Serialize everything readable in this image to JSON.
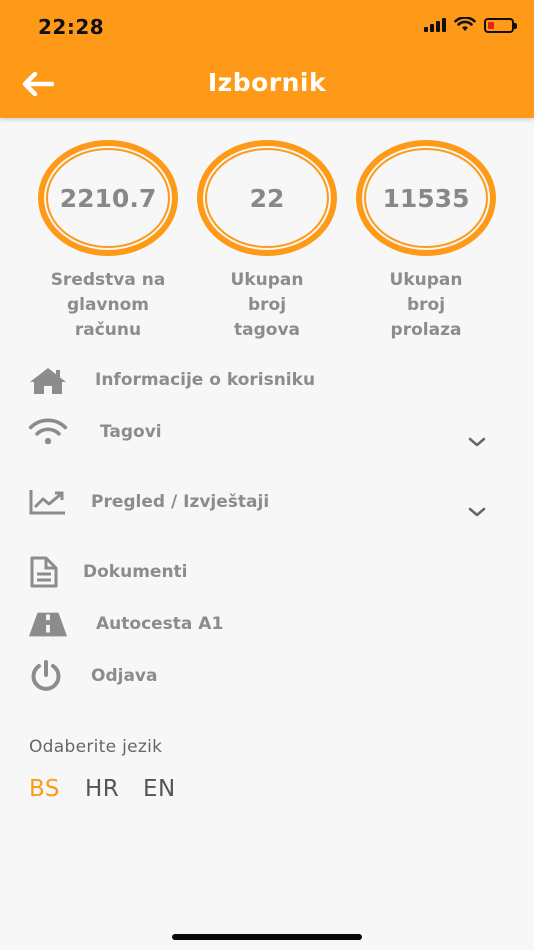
{
  "status_bar": {
    "time": "22:28",
    "battery_fraction": 0.25
  },
  "header": {
    "title": "Izbornik",
    "back_icon": "arrow-left-icon",
    "background": "#fe9a17"
  },
  "stats": [
    {
      "value": "2210.7",
      "label_lines": [
        "Sredstva na",
        "glavnom",
        "računu"
      ]
    },
    {
      "value": "22",
      "label_lines": [
        "Ukupan",
        "broj",
        "tagova"
      ]
    },
    {
      "value": "11535",
      "label_lines": [
        "Ukupan",
        "broj",
        "prolaza"
      ]
    }
  ],
  "menu": [
    {
      "label": "Informacije o korisniku",
      "icon": "home-icon"
    },
    {
      "label": "Tagovi",
      "icon": "wifi-icon",
      "expandable": true
    },
    {
      "label": "Pregled / Izvještaji",
      "icon": "chart-icon",
      "expandable": true
    },
    {
      "label": "Dokumenti",
      "icon": "document-icon"
    },
    {
      "label": "Autocesta A1",
      "icon": "road-icon"
    },
    {
      "label": "Odjava",
      "icon": "power-icon"
    }
  ],
  "language": {
    "title": "Odaberite jezik",
    "options": [
      "BS",
      "HR",
      "EN"
    ],
    "selected": "BS",
    "accent": "#fe9a17"
  }
}
